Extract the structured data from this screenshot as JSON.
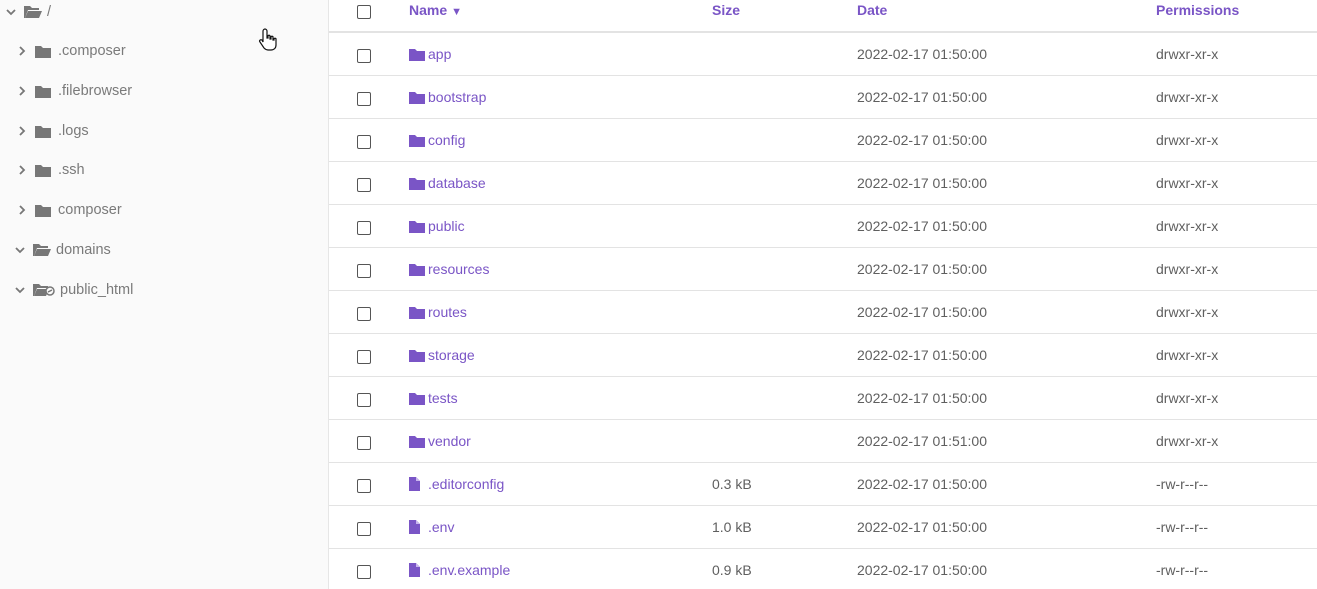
{
  "sidebar": {
    "root": {
      "label": "/",
      "icon": "folder-open-icon",
      "expanded": true
    },
    "items": [
      {
        "label": ".composer",
        "icon": "folder-icon",
        "expanded": false
      },
      {
        "label": ".filebrowser",
        "icon": "folder-icon",
        "expanded": false
      },
      {
        "label": ".logs",
        "icon": "folder-icon",
        "expanded": false
      },
      {
        "label": ".ssh",
        "icon": "folder-icon",
        "expanded": false
      },
      {
        "label": "composer",
        "icon": "folder-icon",
        "expanded": false
      },
      {
        "label": "domains",
        "icon": "folder-open-icon",
        "expanded": true
      },
      {
        "label": "public_html",
        "icon": "folder-symlink-icon",
        "expanded": true
      }
    ]
  },
  "table": {
    "headers": {
      "name": "Name",
      "sort_indicator": "▼",
      "size": "Size",
      "date": "Date",
      "permissions": "Permissions"
    },
    "rows": [
      {
        "name": "app",
        "type": "folder",
        "size": "",
        "date": "2022-02-17 01:50:00",
        "permissions": "drwxr-xr-x"
      },
      {
        "name": "bootstrap",
        "type": "folder",
        "size": "",
        "date": "2022-02-17 01:50:00",
        "permissions": "drwxr-xr-x"
      },
      {
        "name": "config",
        "type": "folder",
        "size": "",
        "date": "2022-02-17 01:50:00",
        "permissions": "drwxr-xr-x"
      },
      {
        "name": "database",
        "type": "folder",
        "size": "",
        "date": "2022-02-17 01:50:00",
        "permissions": "drwxr-xr-x"
      },
      {
        "name": "public",
        "type": "folder",
        "size": "",
        "date": "2022-02-17 01:50:00",
        "permissions": "drwxr-xr-x"
      },
      {
        "name": "resources",
        "type": "folder",
        "size": "",
        "date": "2022-02-17 01:50:00",
        "permissions": "drwxr-xr-x"
      },
      {
        "name": "routes",
        "type": "folder",
        "size": "",
        "date": "2022-02-17 01:50:00",
        "permissions": "drwxr-xr-x"
      },
      {
        "name": "storage",
        "type": "folder",
        "size": "",
        "date": "2022-02-17 01:50:00",
        "permissions": "drwxr-xr-x"
      },
      {
        "name": "tests",
        "type": "folder",
        "size": "",
        "date": "2022-02-17 01:50:00",
        "permissions": "drwxr-xr-x"
      },
      {
        "name": "vendor",
        "type": "folder",
        "size": "",
        "date": "2022-02-17 01:51:00",
        "permissions": "drwxr-xr-x"
      },
      {
        "name": ".editorconfig",
        "type": "file",
        "size": "0.3 kB",
        "date": "2022-02-17 01:50:00",
        "permissions": "-rw-r--r--"
      },
      {
        "name": ".env",
        "type": "file",
        "size": "1.0 kB",
        "date": "2022-02-17 01:50:00",
        "permissions": "-rw-r--r--"
      },
      {
        "name": ".env.example",
        "type": "file",
        "size": "0.9 kB",
        "date": "2022-02-17 01:50:00",
        "permissions": "-rw-r--r--"
      }
    ]
  },
  "colors": {
    "accent": "#7a55c6",
    "text": "#5f5f5f",
    "sidebar_text": "#7a7a7a",
    "sidebar_bg": "#fafafa",
    "divider": "#e3e3e3"
  }
}
